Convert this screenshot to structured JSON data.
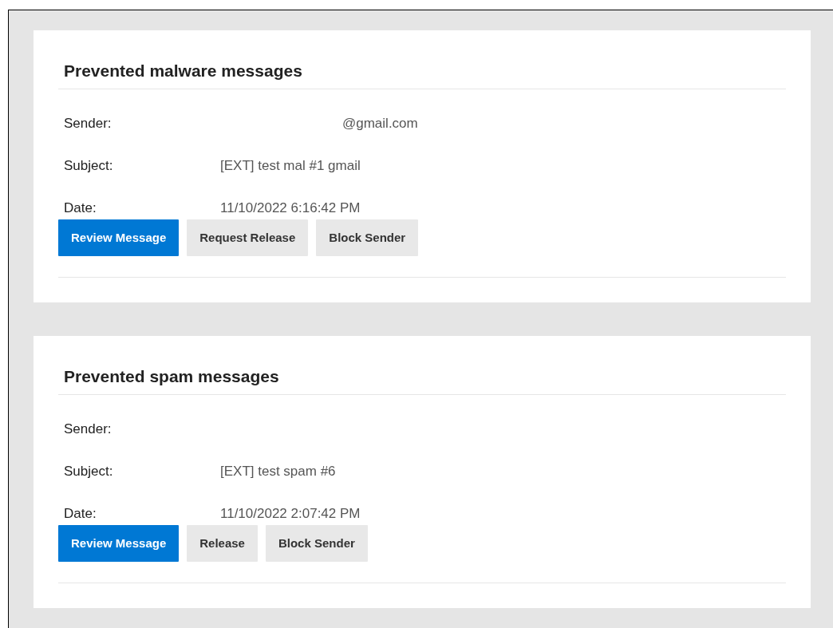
{
  "sections": [
    {
      "title": "Prevented malware messages",
      "fields": [
        {
          "label": "Sender:",
          "value": "@gmail.com",
          "redacted_prefix": true
        },
        {
          "label": "Subject:",
          "value": "[EXT] test mal #1 gmail",
          "redacted_prefix": false
        },
        {
          "label": "Date:",
          "value": "11/10/2022 6:16:42 PM",
          "redacted_prefix": false
        }
      ],
      "buttons": [
        {
          "label": "Review Message",
          "kind": "primary"
        },
        {
          "label": "Request Release",
          "kind": "secondary"
        },
        {
          "label": "Block Sender",
          "kind": "secondary"
        }
      ]
    },
    {
      "title": "Prevented spam messages",
      "fields": [
        {
          "label": "Sender:"
        },
        {
          "label": "Subject:",
          "value": "[EXT] test spam #6",
          "redacted_prefix": false
        },
        {
          "label": "Date:",
          "value": "11/10/2022 2:07:42 PM",
          "redacted_prefix": false
        }
      ],
      "buttons": [
        {
          "label": "Review Message",
          "kind": "primary"
        },
        {
          "label": "Release",
          "kind": "secondary"
        },
        {
          "label": "Block Sender",
          "kind": "secondary"
        }
      ]
    }
  ]
}
